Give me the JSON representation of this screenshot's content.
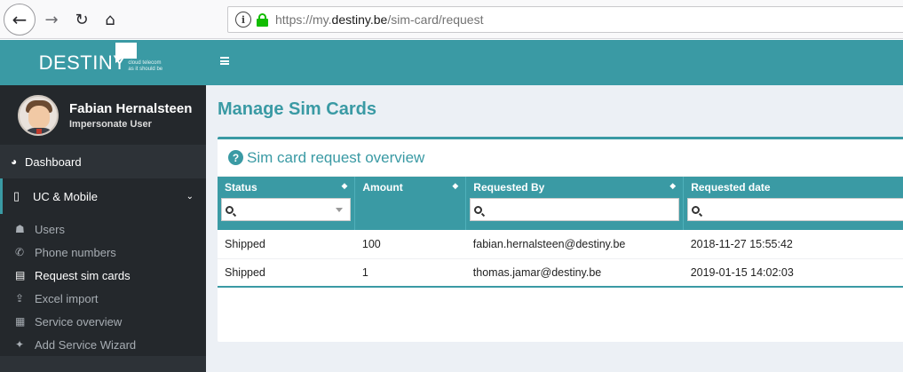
{
  "browser": {
    "url_prefix": "https://my.",
    "url_domain": "destiny.be",
    "url_path": "/sim-card/request"
  },
  "brand": {
    "name": "DESTINY",
    "tagline": "cloud telecom as it should be"
  },
  "user": {
    "name": "Fabian Hernalsteen",
    "role": "Impersonate User"
  },
  "menu": {
    "dashboard": "Dashboard",
    "uc_mobile": "UC & Mobile",
    "sub_items": [
      {
        "label": "Users"
      },
      {
        "label": "Phone numbers"
      },
      {
        "label": "Request sim cards"
      },
      {
        "label": "Excel import"
      },
      {
        "label": "Service overview"
      },
      {
        "label": "Add Service Wizard"
      }
    ]
  },
  "page": {
    "title": "Manage Sim Cards",
    "box_title": "Sim card request overview"
  },
  "table": {
    "headers": [
      "Status",
      "Amount",
      "Requested By",
      "Requested date"
    ],
    "rows": [
      {
        "status": "Shipped",
        "amount": "100",
        "requested_by": "fabian.hernalsteen@destiny.be",
        "requested_date": "2018-11-27 15:55:42"
      },
      {
        "status": "Shipped",
        "amount": "1",
        "requested_by": "thomas.jamar@destiny.be",
        "requested_date": "2019-01-15 14:02:03"
      }
    ]
  },
  "colors": {
    "accent": "#3a9aa4",
    "sidebar": "#2d3237"
  }
}
